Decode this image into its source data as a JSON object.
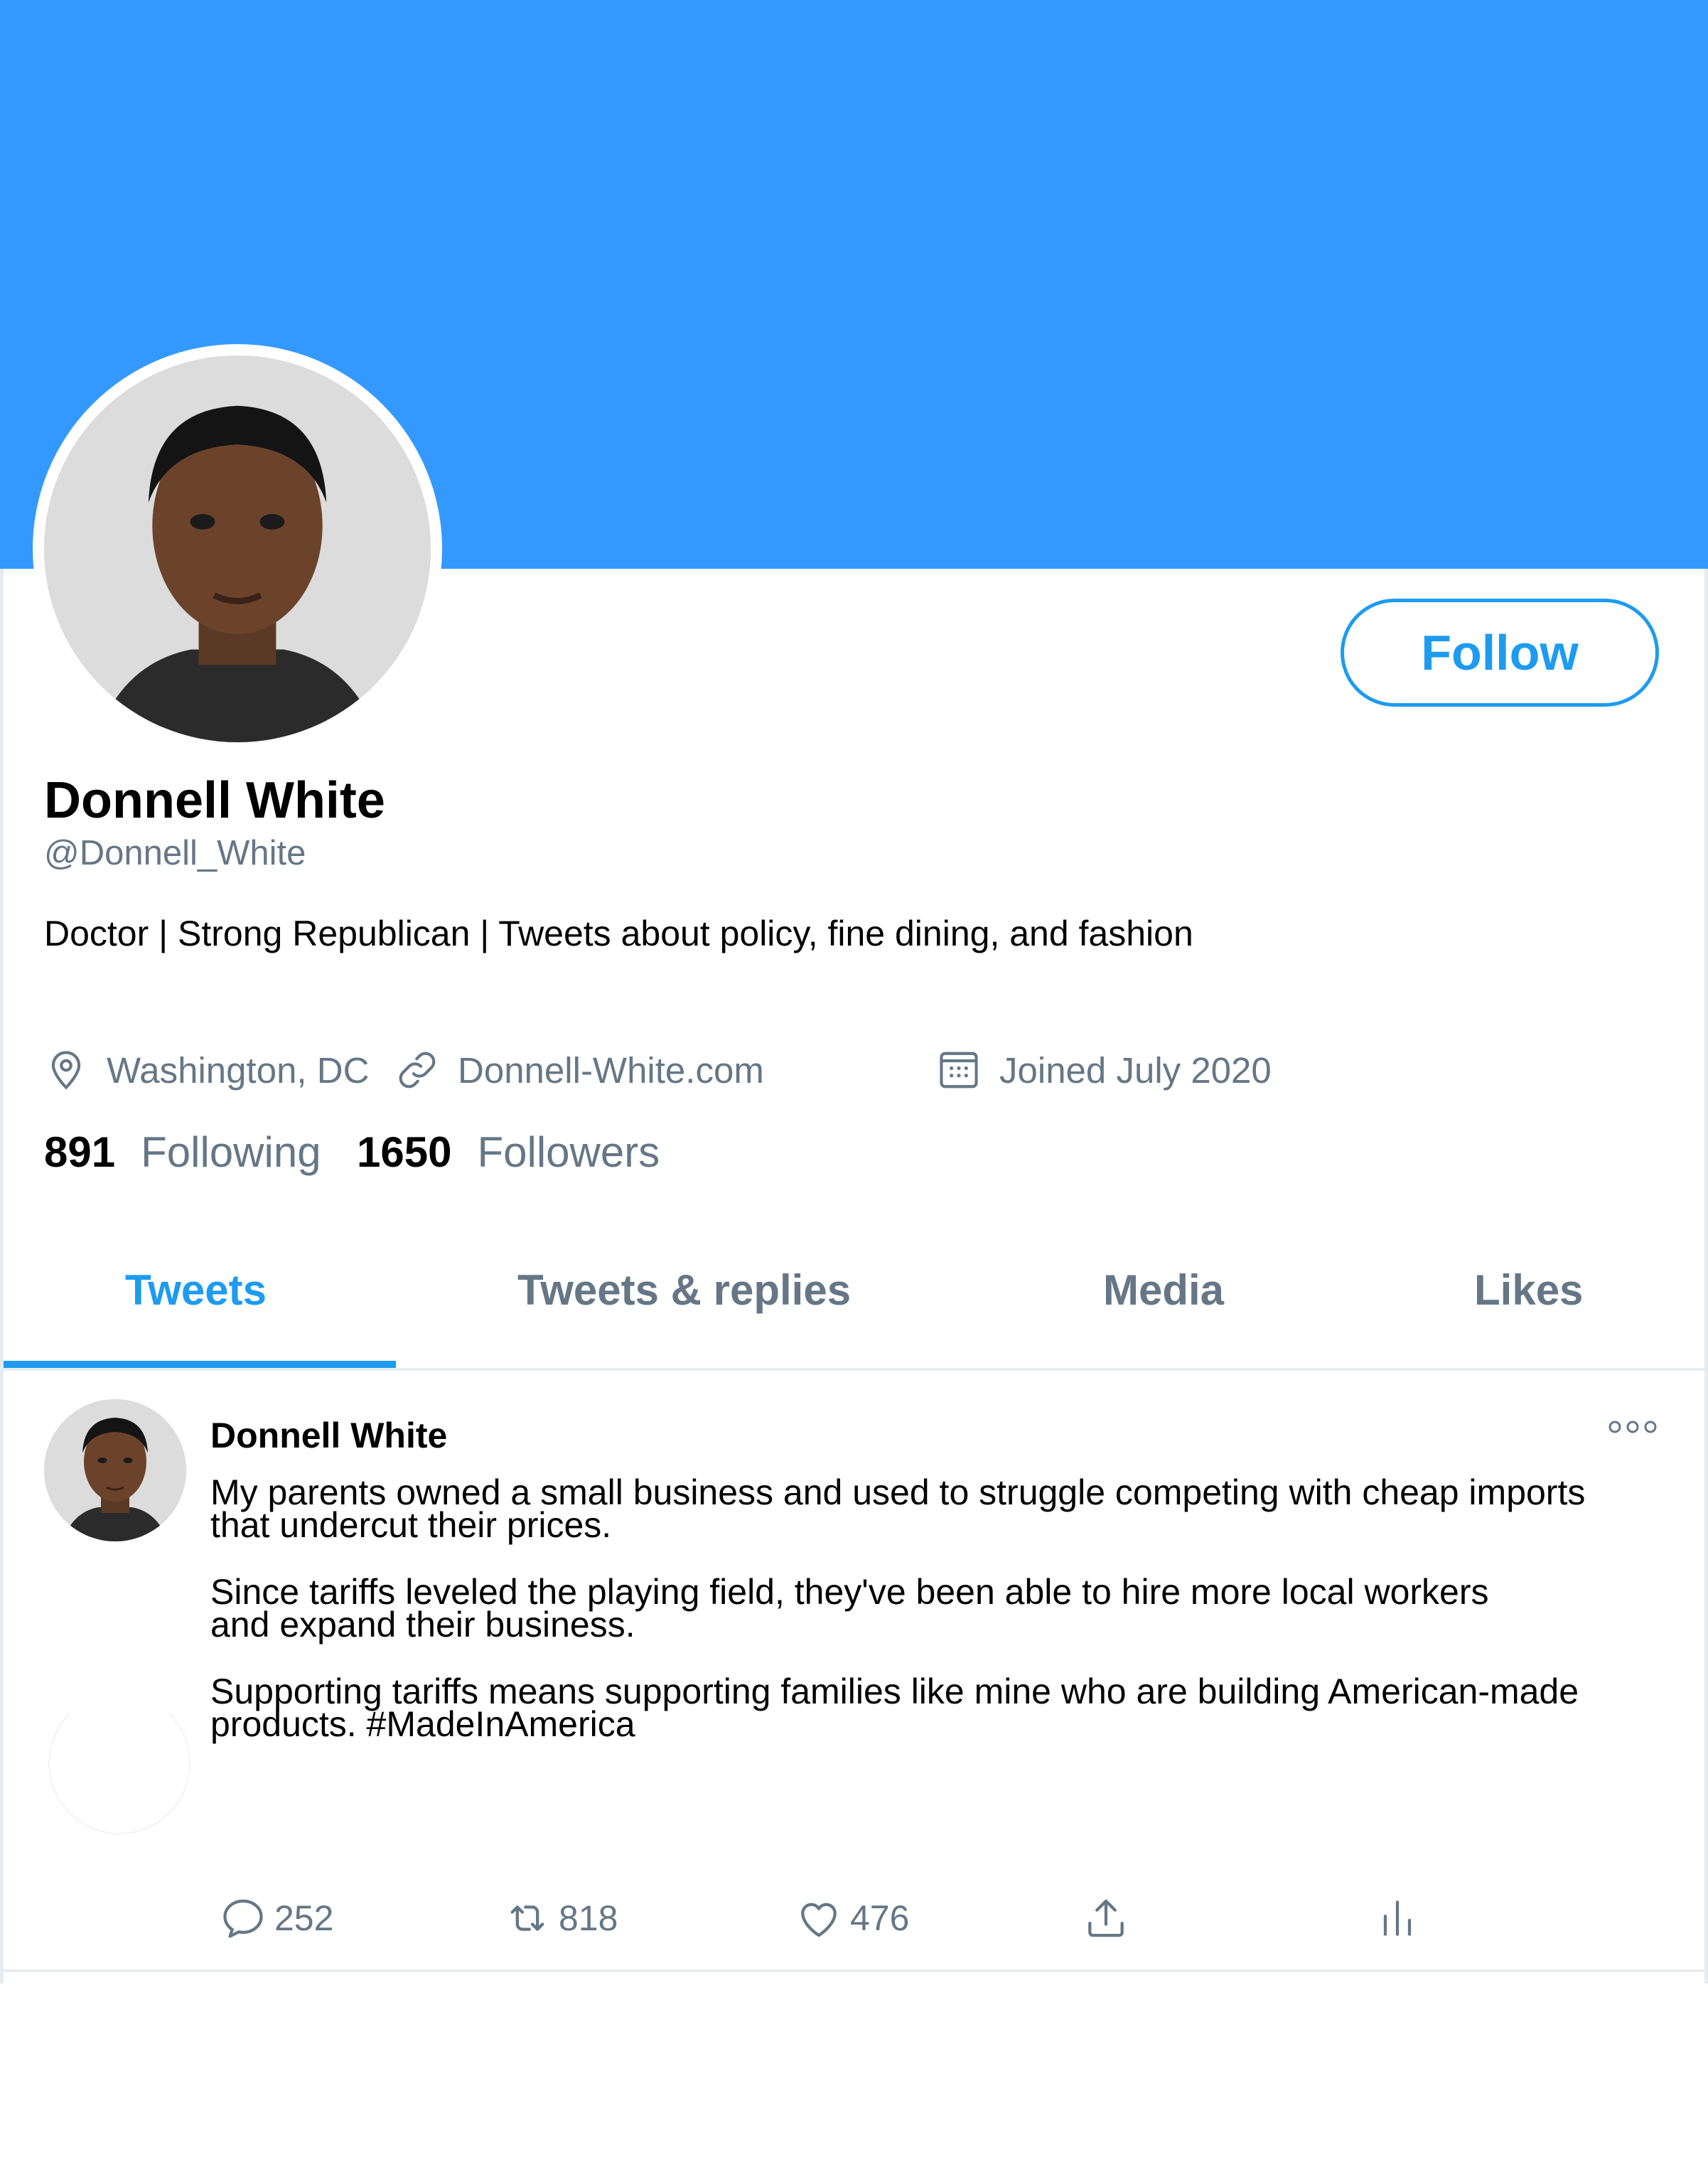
{
  "profile": {
    "display_name": "Donnell White",
    "handle": "@Donnell_White",
    "bio": "Doctor | Strong Republican | Tweets about policy, fine dining, and fashion",
    "location": "Washington, DC",
    "website": "Donnell-White.com",
    "joined": "Joined July 2020",
    "following_count": "891",
    "following_label": "Following",
    "followers_count": "1650",
    "followers_label": "Followers",
    "follow_button": "Follow"
  },
  "tabs": [
    {
      "label": "Tweets",
      "active": true
    },
    {
      "label": "Tweets & replies",
      "active": false
    },
    {
      "label": "Media",
      "active": false
    },
    {
      "label": "Likes",
      "active": false
    }
  ],
  "tweet": {
    "author": "Donnell White",
    "paragraphs": [
      "My parents owned a small business  and used to struggle competing with cheap imports\nthat undercut their prices.",
      "Since tariffs leveled the playing field, they've been able to hire more local workers\nand expand their business.",
      "Supporting tariffs means supporting families like mine who are building American-made\nproducts. #MadeInAmerica"
    ],
    "replies": "252",
    "retweets": "818",
    "likes": "476"
  },
  "colors": {
    "banner": "#3399ff",
    "accent": "#1d9bf0",
    "secondary_text": "#657786"
  },
  "icons": [
    "location-pin-icon",
    "link-icon",
    "calendar-icon",
    "more-icon",
    "reply-icon",
    "retweet-icon",
    "like-icon",
    "share-icon",
    "analytics-icon"
  ]
}
